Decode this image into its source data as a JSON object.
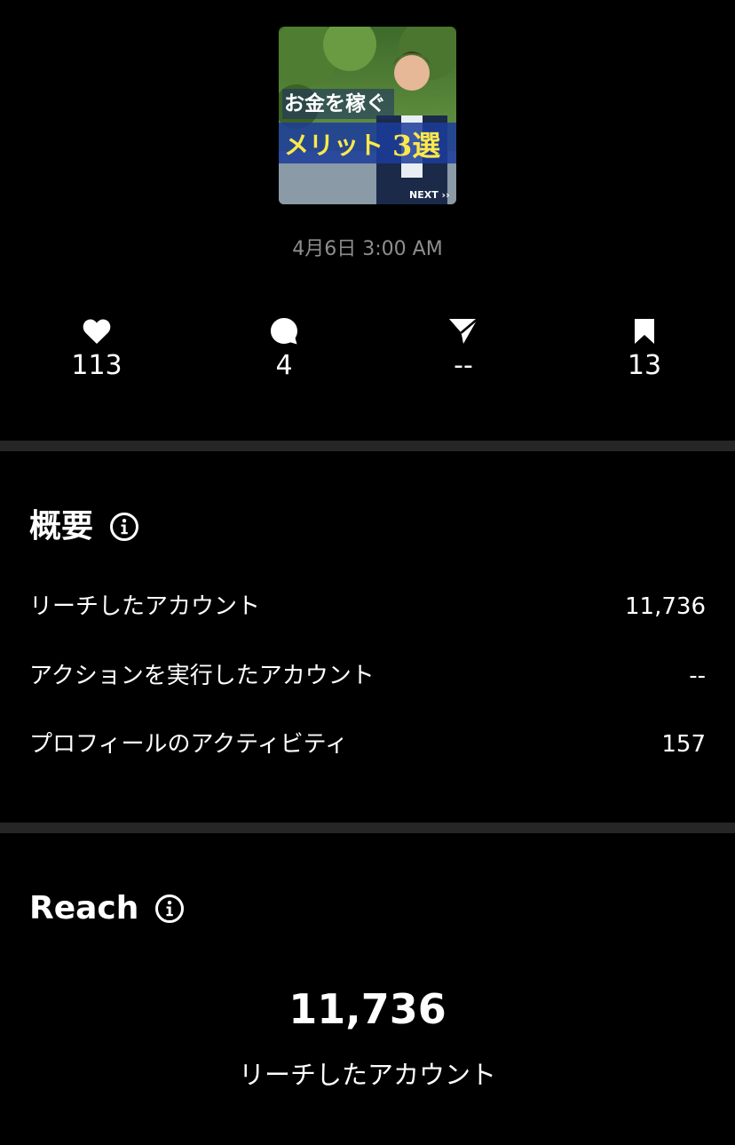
{
  "post": {
    "thumbnail": {
      "headline_top": "お金を稼ぐ",
      "headline_main": "メリット",
      "headline_num": "3選",
      "next_label": "NEXT ››"
    },
    "date": "4月6日 3:00 AM"
  },
  "stats": {
    "likes": "113",
    "comments": "4",
    "shares": "--",
    "saves": "13"
  },
  "overview": {
    "title": "概要",
    "rows": [
      {
        "label": "リーチしたアカウント",
        "value": "11,736"
      },
      {
        "label": "アクションを実行したアカウント",
        "value": "--"
      },
      {
        "label": "プロフィールのアクティビティ",
        "value": "157"
      }
    ]
  },
  "reach": {
    "title": "Reach",
    "value": "11,736",
    "label": "リーチしたアカウント"
  },
  "colors": {
    "background": "#000000",
    "divider": "#262626",
    "secondary_text": "#8e8e8e",
    "thumbnail_headline": "#ffe94a"
  }
}
